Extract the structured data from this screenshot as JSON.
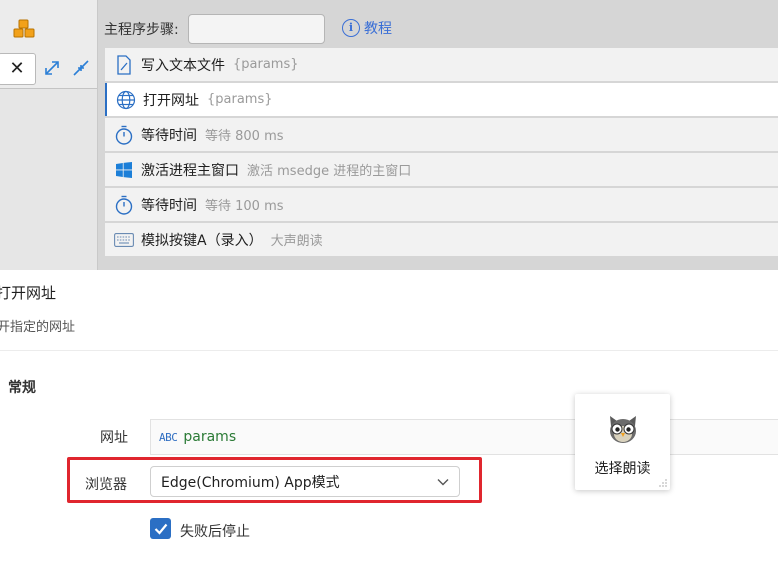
{
  "header": {
    "main_steps_label": "主程序步骤:",
    "steps_input_value": "",
    "tutorial_label": "教程"
  },
  "left_panel": {
    "close_glyph": "✕"
  },
  "steps": [
    {
      "name": "写入文本文件",
      "desc": "{params}",
      "icon": "file-edit-icon"
    },
    {
      "name": "打开网址",
      "desc": "{params}",
      "icon": "globe-icon",
      "selected": true
    },
    {
      "name": "等待时间",
      "desc": "等待 800 ms",
      "icon": "timer-icon"
    },
    {
      "name": "激活进程主窗口",
      "desc": "激活 msedge 进程的主窗口",
      "icon": "windows-icon"
    },
    {
      "name": "等待时间",
      "desc": "等待 100 ms",
      "icon": "timer-icon"
    },
    {
      "name": "模拟按键A（录入）",
      "desc": "大声朗读",
      "icon": "keyboard-icon"
    }
  ],
  "detail": {
    "title": "打开网址",
    "subtitle": "开指定的网址",
    "section": "常规",
    "url_label": "网址",
    "url_type_tag": "ABC",
    "url_value": "params",
    "browser_label": "浏览器",
    "browser_value": "Edge(Chromium) App模式",
    "stop_on_fail_label": "失败后停止",
    "stop_on_fail_checked": true
  },
  "popup": {
    "label": "选择朗读",
    "icon": "owl-icon"
  },
  "colors": {
    "accent": "#2b6fc4",
    "highlight_box": "#e0262e",
    "url_value_color": "#2a7a35"
  }
}
